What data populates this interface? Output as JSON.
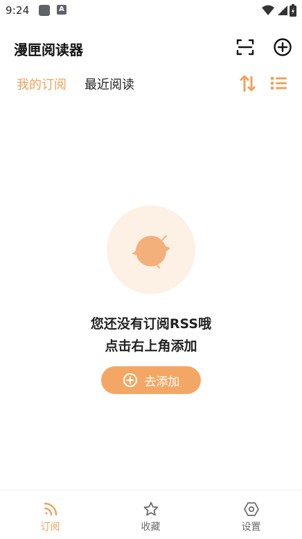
{
  "status": {
    "time": "9:24"
  },
  "header": {
    "title": "漫匣阅读器"
  },
  "tabs": [
    {
      "label": "我的订阅",
      "active": true
    },
    {
      "label": "最近阅读",
      "active": false
    }
  ],
  "empty_state": {
    "line1": "您还没有订阅RSS哦",
    "line2": "点击右上角添加",
    "button_label": "去添加"
  },
  "bottom_nav": [
    {
      "label": "订阅",
      "icon": "rss-icon",
      "active": true
    },
    {
      "label": "收藏",
      "icon": "star-icon",
      "active": false
    },
    {
      "label": "设置",
      "icon": "settings-hexagon-icon",
      "active": false
    }
  ],
  "colors": {
    "accent": "#f0a15c",
    "button": "#f4a764",
    "empty_bg": "#fdf1e6"
  }
}
